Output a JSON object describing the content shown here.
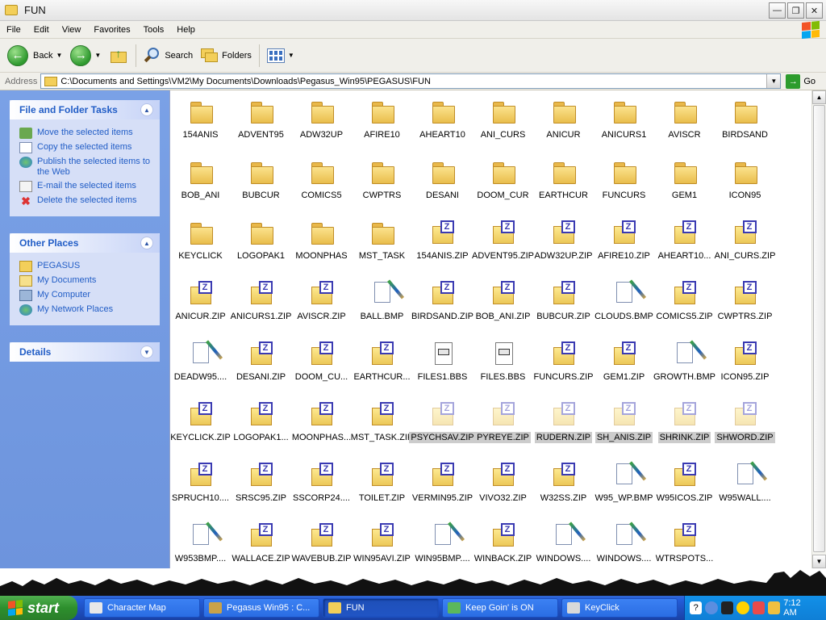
{
  "window": {
    "title": "FUN"
  },
  "menu": [
    "File",
    "Edit",
    "View",
    "Favorites",
    "Tools",
    "Help"
  ],
  "toolbar": {
    "back": "Back",
    "search": "Search",
    "folders": "Folders"
  },
  "address": {
    "label": "Address",
    "path": "C:\\Documents and Settings\\VM2\\My Documents\\Downloads\\Pegasus_Win95\\PEGASUS\\FUN",
    "go": "Go"
  },
  "panels": {
    "file_tasks": {
      "title": "File and Folder Tasks",
      "items": [
        {
          "label": "Move the selected items",
          "icon": "move-icon"
        },
        {
          "label": "Copy the selected items",
          "icon": "copy-icon"
        },
        {
          "label": "Publish the selected items to the Web",
          "icon": "publish-icon"
        },
        {
          "label": "E-mail the selected items",
          "icon": "email-icon"
        },
        {
          "label": "Delete the selected items",
          "icon": "delete-icon"
        }
      ]
    },
    "other_places": {
      "title": "Other Places",
      "items": [
        {
          "label": "PEGASUS",
          "icon": "folder-icon"
        },
        {
          "label": "My Documents",
          "icon": "my-documents-icon"
        },
        {
          "label": "My Computer",
          "icon": "my-computer-icon"
        },
        {
          "label": "My Network Places",
          "icon": "network-places-icon"
        }
      ]
    },
    "details": {
      "title": "Details"
    }
  },
  "files": [
    {
      "name": "154ANIS",
      "type": "folder"
    },
    {
      "name": "ADVENT95",
      "type": "folder"
    },
    {
      "name": "ADW32UP",
      "type": "folder"
    },
    {
      "name": "AFIRE10",
      "type": "folder"
    },
    {
      "name": "AHEART10",
      "type": "folder"
    },
    {
      "name": "ANI_CURS",
      "type": "folder"
    },
    {
      "name": "ANICUR",
      "type": "folder"
    },
    {
      "name": "ANICURS1",
      "type": "folder"
    },
    {
      "name": "AVISCR",
      "type": "folder"
    },
    {
      "name": "BIRDSAND",
      "type": "folder"
    },
    {
      "name": "BOB_ANI",
      "type": "folder"
    },
    {
      "name": "BUBCUR",
      "type": "folder"
    },
    {
      "name": "COMICS5",
      "type": "folder"
    },
    {
      "name": "CWPTRS",
      "type": "folder"
    },
    {
      "name": "DESANI",
      "type": "folder"
    },
    {
      "name": "DOOM_CUR",
      "type": "folder"
    },
    {
      "name": "EARTHCUR",
      "type": "folder"
    },
    {
      "name": "FUNCURS",
      "type": "folder"
    },
    {
      "name": "GEM1",
      "type": "folder"
    },
    {
      "name": "ICON95",
      "type": "folder"
    },
    {
      "name": "KEYCLICK",
      "type": "folder"
    },
    {
      "name": "LOGOPAK1",
      "type": "folder"
    },
    {
      "name": "MOONPHAS",
      "type": "folder"
    },
    {
      "name": "MST_TASK",
      "type": "folder"
    },
    {
      "name": "154ANIS.ZIP",
      "type": "zip"
    },
    {
      "name": "ADVENT95.ZIP",
      "type": "zip"
    },
    {
      "name": "ADW32UP.ZIP",
      "type": "zip"
    },
    {
      "name": "AFIRE10.ZIP",
      "type": "zip"
    },
    {
      "name": "AHEART10...",
      "type": "zip"
    },
    {
      "name": "ANI_CURS.ZIP",
      "type": "zip"
    },
    {
      "name": "ANICUR.ZIP",
      "type": "zip"
    },
    {
      "name": "ANICURS1.ZIP",
      "type": "zip"
    },
    {
      "name": "AVISCR.ZIP",
      "type": "zip"
    },
    {
      "name": "BALL.BMP",
      "type": "bmp"
    },
    {
      "name": "BIRDSAND.ZIP",
      "type": "zip"
    },
    {
      "name": "BOB_ANI.ZIP",
      "type": "zip"
    },
    {
      "name": "BUBCUR.ZIP",
      "type": "zip"
    },
    {
      "name": "CLOUDS.BMP",
      "type": "bmp"
    },
    {
      "name": "COMICS5.ZIP",
      "type": "zip"
    },
    {
      "name": "CWPTRS.ZIP",
      "type": "zip"
    },
    {
      "name": "DEADW95....",
      "type": "bmp"
    },
    {
      "name": "DESANI.ZIP",
      "type": "zip"
    },
    {
      "name": "DOOM_CU...",
      "type": "zip"
    },
    {
      "name": "EARTHCUR...",
      "type": "zip"
    },
    {
      "name": "FILES1.BBS",
      "type": "bbs"
    },
    {
      "name": "FILES.BBS",
      "type": "bbs"
    },
    {
      "name": "FUNCURS.ZIP",
      "type": "zip"
    },
    {
      "name": "GEM1.ZIP",
      "type": "zip"
    },
    {
      "name": "GROWTH.BMP",
      "type": "bmp"
    },
    {
      "name": "ICON95.ZIP",
      "type": "zip"
    },
    {
      "name": "KEYCLICK.ZIP",
      "type": "zip"
    },
    {
      "name": "LOGOPAK1...",
      "type": "zip"
    },
    {
      "name": "MOONPHAS...",
      "type": "zip"
    },
    {
      "name": "MST_TASK.ZIP",
      "type": "zip"
    },
    {
      "name": "PSYCHSAV.ZIP",
      "type": "zip",
      "selected": true
    },
    {
      "name": "PYREYE.ZIP",
      "type": "zip",
      "selected": true
    },
    {
      "name": "RUDERN.ZIP",
      "type": "zip",
      "selected": true
    },
    {
      "name": "SH_ANIS.ZIP",
      "type": "zip",
      "selected": true
    },
    {
      "name": "SHRINK.ZIP",
      "type": "zip",
      "selected": true
    },
    {
      "name": "SHWORD.ZIP",
      "type": "zip",
      "selected": true
    },
    {
      "name": "SPRUCH10....",
      "type": "zip"
    },
    {
      "name": "SRSC95.ZIP",
      "type": "zip"
    },
    {
      "name": "SSCORP24....",
      "type": "zip"
    },
    {
      "name": "TOILET.ZIP",
      "type": "zip"
    },
    {
      "name": "VERMIN95.ZIP",
      "type": "zip"
    },
    {
      "name": "VIVO32.ZIP",
      "type": "zip"
    },
    {
      "name": "W32SS.ZIP",
      "type": "zip"
    },
    {
      "name": "W95_WP.BMP",
      "type": "bmp"
    },
    {
      "name": "W95ICOS.ZIP",
      "type": "zip"
    },
    {
      "name": "W95WALL....",
      "type": "bmp"
    },
    {
      "name": "W953BMP....",
      "type": "bmp"
    },
    {
      "name": "WALLACE.ZIP",
      "type": "zip"
    },
    {
      "name": "WAVEBUB.ZIP",
      "type": "zip"
    },
    {
      "name": "WIN95AVI.ZIP",
      "type": "zip"
    },
    {
      "name": "WIN95BMP....",
      "type": "bmp"
    },
    {
      "name": "WINBACK.ZIP",
      "type": "zip"
    },
    {
      "name": "WINDOWS....",
      "type": "bmp"
    },
    {
      "name": "WINDOWS....",
      "type": "bmp"
    },
    {
      "name": "WTRSPOTS...",
      "type": "zip"
    }
  ],
  "taskbar": {
    "start": "start",
    "tasks": [
      {
        "label": "Character Map",
        "active": false
      },
      {
        "label": "Pegasus Win95 : C...",
        "active": false
      },
      {
        "label": "FUN",
        "active": true
      },
      {
        "label": "Keep Goin' is ON",
        "active": false
      },
      {
        "label": "KeyClick",
        "active": false
      }
    ],
    "clock": "7:12 AM"
  },
  "colors": {
    "accent": "#215dc6",
    "taskbar": "#245edb",
    "start": "#2d8f2d"
  }
}
